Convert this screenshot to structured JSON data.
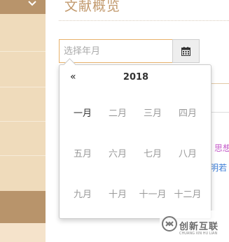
{
  "page": {
    "title": "文献概览"
  },
  "month_picker": {
    "placeholder": "选择年月",
    "year": "2018",
    "prev_label": "«",
    "months": [
      "一月",
      "二月",
      "三月",
      "四月",
      "五月",
      "六月",
      "七月",
      "八月",
      "九月",
      "十月",
      "十一月",
      "十二月"
    ],
    "current_month_index": 0
  },
  "background_fragments": {
    "purple_text": "思想",
    "blue_text": "明若"
  },
  "watermark": {
    "cn": "创新互联",
    "en": "CHUANG XIN HU LIAN"
  },
  "colors": {
    "sidebar": "#efdbbb",
    "sidebar_dark": "#b8946b",
    "title": "#c29a6e",
    "input_focus_border": "#e8b16b"
  },
  "icons": {
    "sidebar_toggle": "chevron-down-icon",
    "calendar_button": "calendar-icon",
    "watermark_logo": "logo-icon"
  }
}
